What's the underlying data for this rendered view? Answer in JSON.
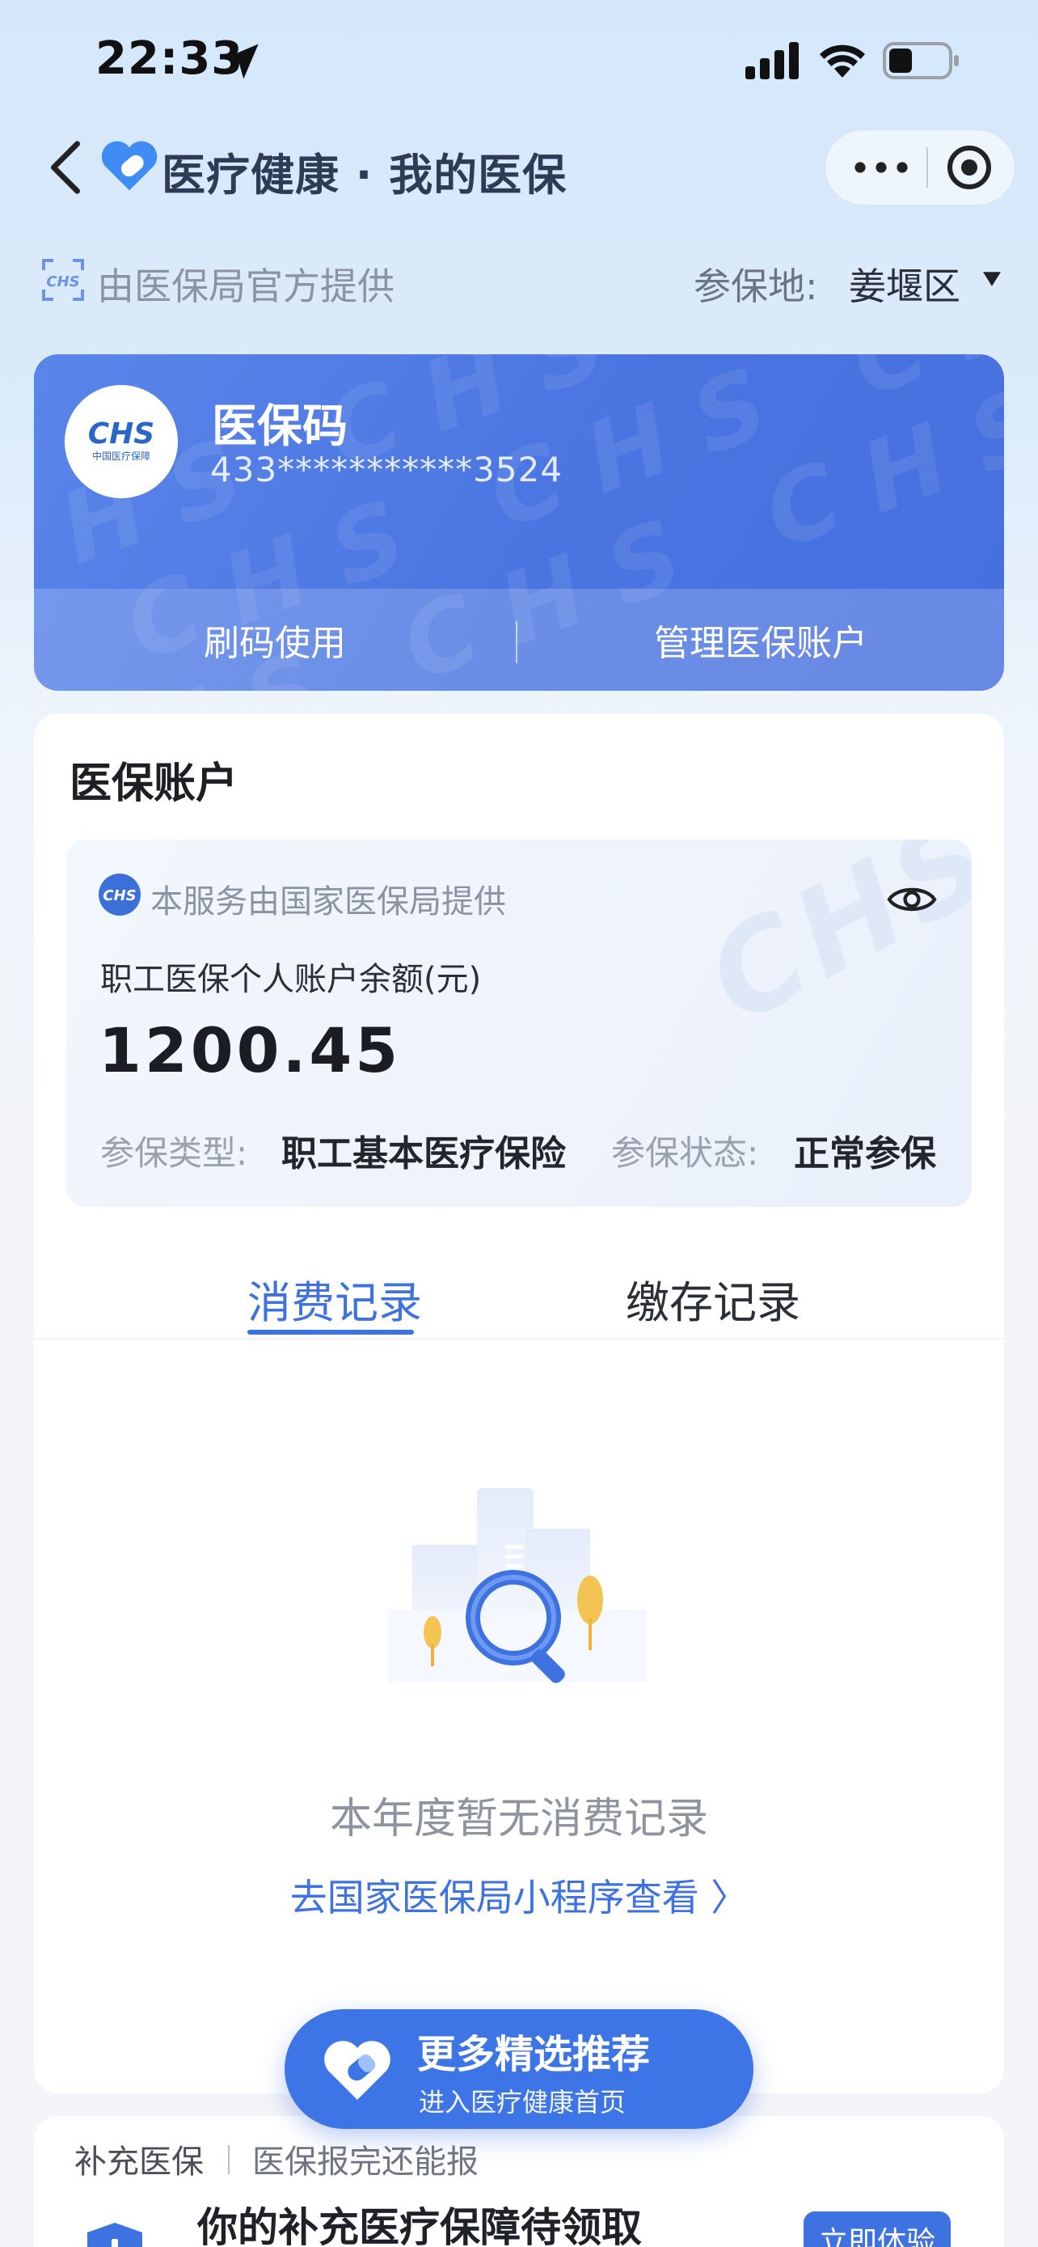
{
  "status_bar": {
    "time": "22:33"
  },
  "nav": {
    "title": "医疗健康 · 我的医保"
  },
  "provider": {
    "text": "由医保局官方提供",
    "region_label": "参保地:",
    "region_value": "姜堰区"
  },
  "code_card": {
    "logo_text": "CHS",
    "logo_sub": "中国医疗保障",
    "title": "医保码",
    "number": "433***********3524",
    "action_scan": "刷码使用",
    "action_manage": "管理医保账户"
  },
  "account": {
    "title": "医保账户",
    "service_text": "本服务由国家医保局提供",
    "balance_label": "职工医保个人账户余额(元)",
    "balance_value": "1200.45",
    "type_label": "参保类型:",
    "type_value": "职工基本医疗保险",
    "status_label": "参保状态:",
    "status_value": "正常参保"
  },
  "tabs": [
    {
      "label": "消费记录",
      "active": true
    },
    {
      "label": "缴存记录",
      "active": false
    }
  ],
  "empty": {
    "text": "本年度暂无消费记录",
    "link": "去国家医保局小程序查看 〉"
  },
  "recommend": {
    "title": "更多精选推荐",
    "subtitle": "进入医疗健康首页"
  },
  "supplement": {
    "tag": "补充医保",
    "subtitle": "医保报完还能报",
    "title": "你的补充医疗保障待领取",
    "button": "立即体验"
  },
  "colors": {
    "accent": "#3e72e0",
    "card_blue": "#4a74e0"
  }
}
